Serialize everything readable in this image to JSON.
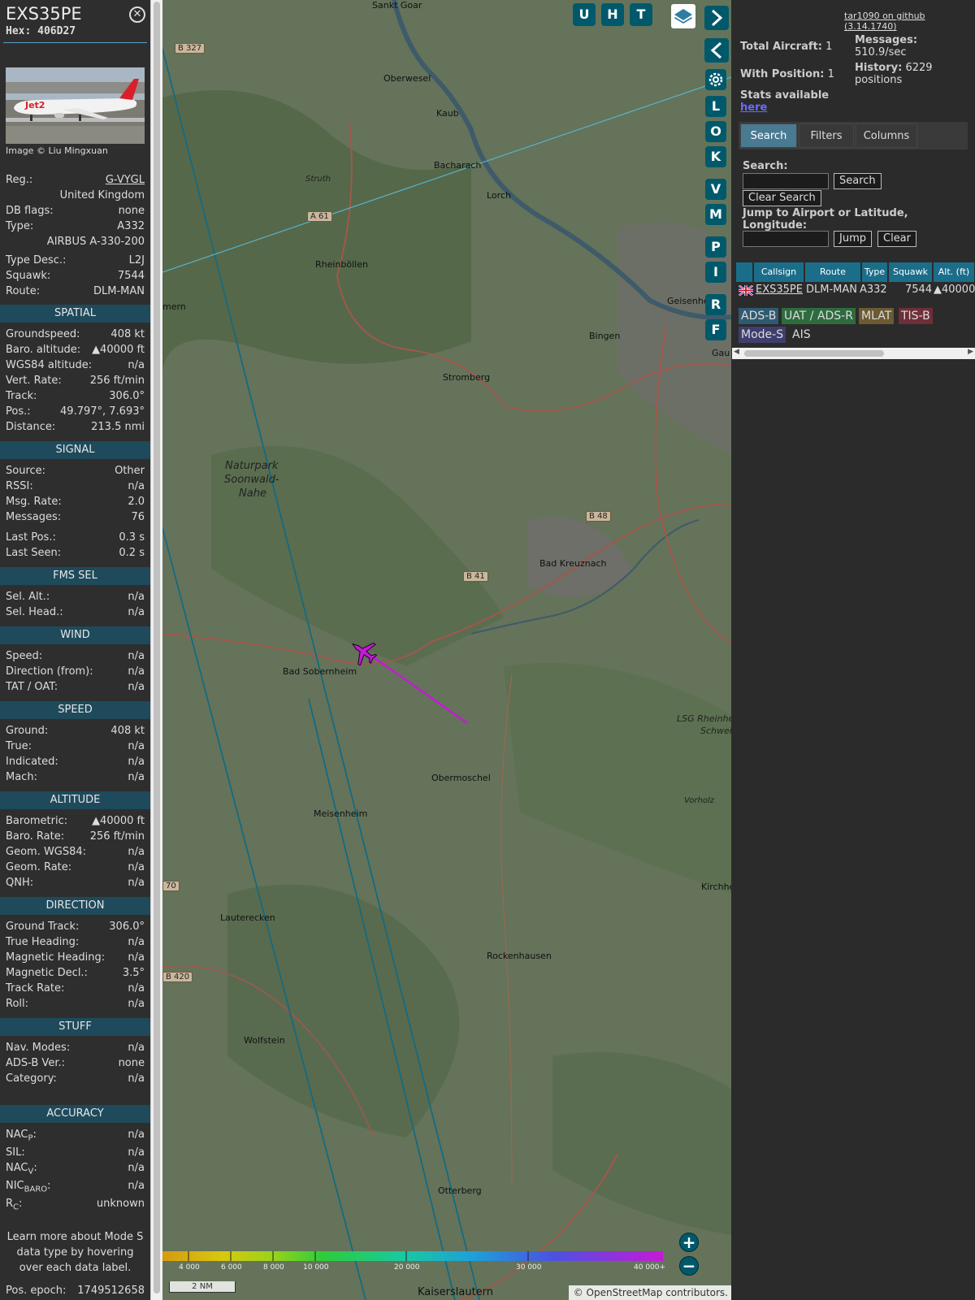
{
  "aircraft": {
    "callsign": "EXS35PE",
    "hex": "Hex: 406D27",
    "image_credit": "Image © Liu Mingxuan",
    "photo_livery_text": "Jet2"
  },
  "info": {
    "reg_label": "Reg.:",
    "reg_value": "G-VYGL",
    "country": "United Kingdom",
    "dbflags_label": "DB flags:",
    "dbflags_value": "none",
    "type_label": "Type:",
    "type_value": "A332",
    "type_name": "AIRBUS A-330-200",
    "typedesc_label": "Type Desc.:",
    "typedesc_value": "L2J",
    "squawk_label": "Squawk:",
    "squawk_value": "7544",
    "route_label": "Route:",
    "route_value": "DLM-MAN"
  },
  "sections": {
    "spatial": "SPATIAL",
    "signal": "SIGNAL",
    "fms": "FMS SEL",
    "wind": "WIND",
    "speed": "SPEED",
    "altitude": "ALTITUDE",
    "direction": "DIRECTION",
    "stuff": "STUFF",
    "accuracy": "ACCURACY"
  },
  "spatial": {
    "groundspeed_label": "Groundspeed:",
    "groundspeed_value": "408 kt",
    "baro_label": "Baro. altitude:",
    "baro_value": "▲40000 ft",
    "wgs_label": "WGS84 altitude:",
    "wgs_value": "n/a",
    "vert_label": "Vert. Rate:",
    "vert_value": "256 ft/min",
    "track_label": "Track:",
    "track_value": "306.0°",
    "pos_label": "Pos.:",
    "pos_value": "49.797°, 7.693°",
    "dist_label": "Distance:",
    "dist_value": "213.5 nmi"
  },
  "signal": {
    "source_label": "Source:",
    "source_value": "Other",
    "rssi_label": "RSSI:",
    "rssi_value": "n/a",
    "msgrate_label": "Msg. Rate:",
    "msgrate_value": "2.0",
    "messages_label": "Messages:",
    "messages_value": "76",
    "lastpos_label": "Last Pos.:",
    "lastpos_value": "0.3 s",
    "lastseen_label": "Last Seen:",
    "lastseen_value": "0.2 s"
  },
  "fms": {
    "selalt_label": "Sel. Alt.:",
    "selalt_value": "n/a",
    "selhead_label": "Sel. Head.:",
    "selhead_value": "n/a"
  },
  "wind": {
    "speed_label": "Speed:",
    "speed_value": "n/a",
    "dir_label": "Direction (from):",
    "dir_value": "n/a",
    "tat_label": "TAT / OAT:",
    "tat_value": "n/a"
  },
  "speed": {
    "ground_label": "Ground:",
    "ground_value": "408 kt",
    "true_label": "True:",
    "true_value": "n/a",
    "ind_label": "Indicated:",
    "ind_value": "n/a",
    "mach_label": "Mach:",
    "mach_value": "n/a"
  },
  "altitude": {
    "baro_label": "Barometric:",
    "baro_value": "▲40000 ft",
    "rate_label": "Baro. Rate:",
    "rate_value": "256 ft/min",
    "geom_label": "Geom. WGS84:",
    "geom_value": "n/a",
    "geomrate_label": "Geom. Rate:",
    "geomrate_value": "n/a",
    "qnh_label": "QNH:",
    "qnh_value": "n/a"
  },
  "direction": {
    "gt_label": "Ground Track:",
    "gt_value": "306.0°",
    "th_label": "True Heading:",
    "th_value": "n/a",
    "mh_label": "Magnetic Heading:",
    "mh_value": "n/a",
    "md_label": "Magnetic Decl.:",
    "md_value": "3.5°",
    "tr_label": "Track Rate:",
    "tr_value": "n/a",
    "roll_label": "Roll:",
    "roll_value": "n/a"
  },
  "stuff": {
    "nav_label": "Nav. Modes:",
    "nav_value": "n/a",
    "adsb_label": "ADS-B Ver.:",
    "adsb_value": "none",
    "cat_label": "Category:",
    "cat_value": "n/a"
  },
  "accuracy": {
    "nacp_label": "NAC",
    "nacp_sub": "P",
    "nacp_value": "n/a",
    "sil_label": "SIL:",
    "sil_value": "n/a",
    "nacv_label": "NAC",
    "nacv_sub": "V",
    "nacv_value": "n/a",
    "nic_label": "NIC",
    "nic_sub": "BARO",
    "nic_value": "n/a",
    "rc_label": "R",
    "rc_sub": "C",
    "rc_value": "unknown"
  },
  "note": "Learn more about Mode S data type by hovering over each data label.",
  "epoch_label": "Pos. epoch:",
  "epoch_value": "1749512658",
  "map": {
    "places": [
      "Oberwesel",
      "Kaub",
      "Bacharach",
      "Lorch",
      "Rheinböllen",
      "Bingen",
      "Stromberg",
      "Naturpark",
      "Soonwald-",
      "Nahe",
      "Bad Kreuznach",
      "Bad Sobernheim",
      "Obermoschel",
      "Meisenheim",
      "Lauterecken",
      "Rockenhausen",
      "Wolfstein",
      "Otterberg",
      "Kaiserslautern",
      "Kirchhe",
      "Geisenhe",
      "LSG Rheinhes",
      "Schwei",
      "Vorholz",
      "Struth",
      "Gau",
      "Sankt Goar",
      "mern"
    ],
    "roads": [
      "B 327",
      "A 61",
      "B 48",
      "B 41",
      "B 420",
      "70"
    ],
    "toolbar_letters": [
      "U",
      "H",
      "T"
    ],
    "side_letters": [
      "L",
      "O",
      "K",
      "V",
      "M",
      "P",
      "I",
      "R",
      "F"
    ],
    "alt_legend": [
      "4 000",
      "6 000",
      "8 000",
      "10 000",
      "20 000",
      "30 000",
      "40 000+"
    ],
    "scale": "2 NM",
    "attribution": "© OpenStreetMap contributors."
  },
  "sidebar": {
    "github_link": "tar1090 on github (3.14.1740)",
    "total_label": "Total Aircraft:",
    "total_value": "1",
    "with_pos_label": "With Position:",
    "with_pos_value": "1",
    "messages_label": "Messages:",
    "messages_value": "510.9/sec",
    "history_label": "History:",
    "history_value": "6229",
    "history_unit": "positions",
    "stats_label": "Stats available",
    "stats_link": "here",
    "tabs": [
      "Search",
      "Filters",
      "Columns"
    ],
    "search_label": "Search:",
    "search_button": "Search",
    "clear_search_button": "Clear Search",
    "jump_label": "Jump to Airport or Latitude, Longitude:",
    "jump_button": "Jump",
    "clear_button": "Clear",
    "table_headers": [
      "Callsign",
      "Route",
      "Type",
      "Squawk",
      "Alt. (ft)"
    ],
    "table_row": {
      "callsign": "EXS35PE",
      "route": "DLM-MAN",
      "type": "A332",
      "squawk": "7544",
      "alt": "▲40000"
    },
    "chips": [
      "ADS-B",
      "UAT / ADS-R",
      "MLAT",
      "TIS-B",
      "Mode-S",
      "AIS"
    ]
  },
  "colors": {
    "panel_bg": "#2e2e2e",
    "section_bg": "#1e4a5c",
    "button_teal": "#00596b",
    "aircraft_magenta": "#c41ad6",
    "table_header": "#1b6e8a"
  }
}
